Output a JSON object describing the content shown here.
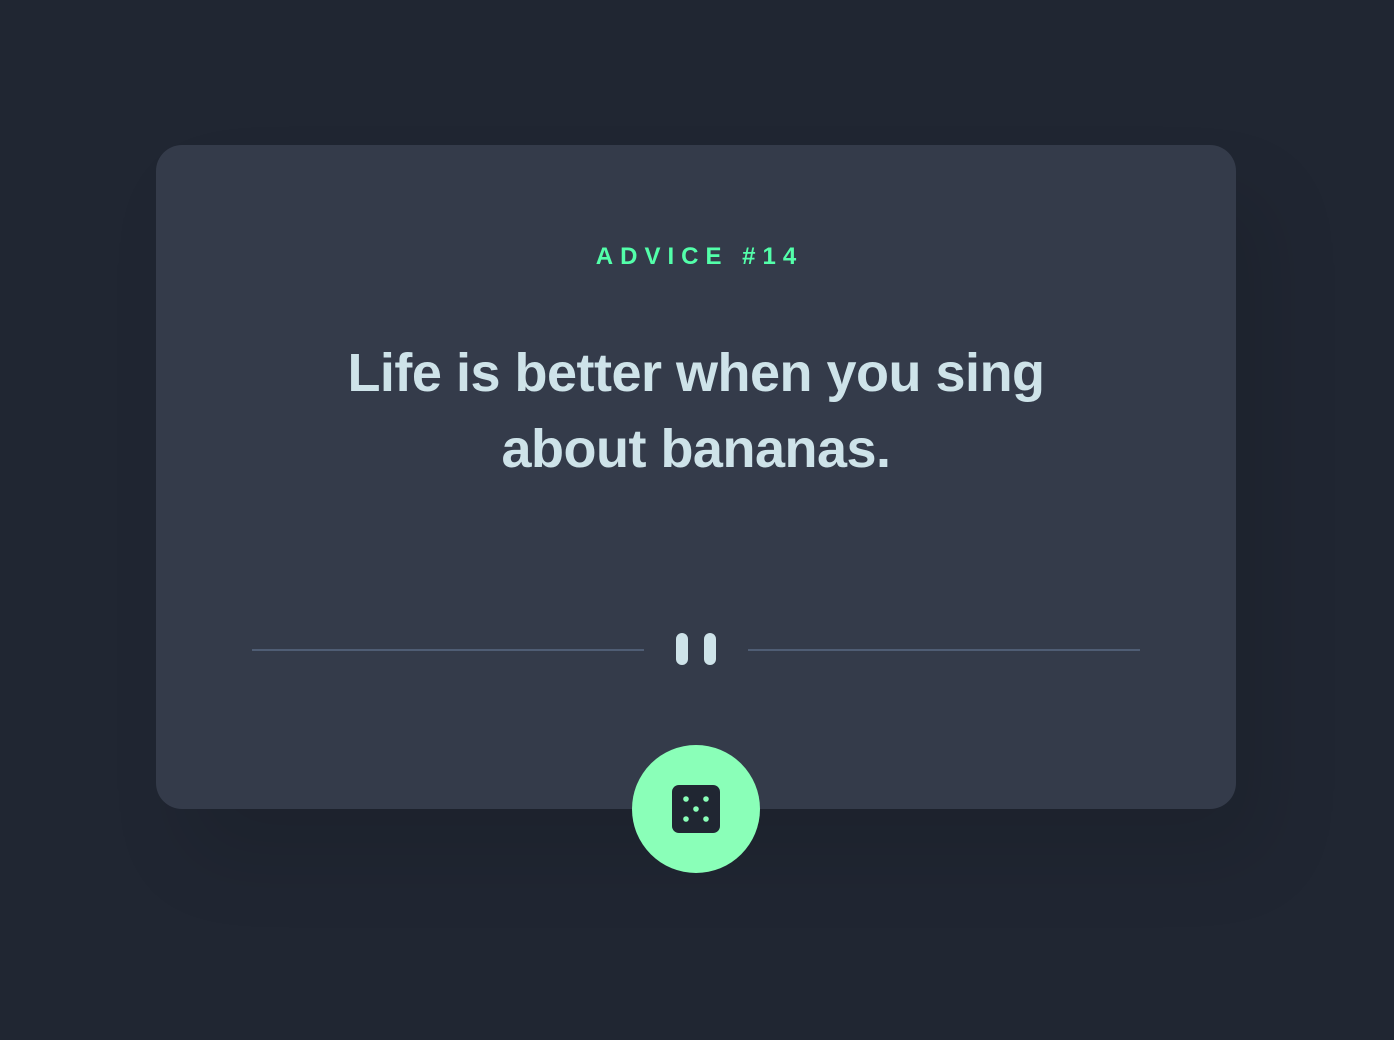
{
  "advice": {
    "label": "ADVICE #14",
    "text": "Life is better when you sing about bananas."
  },
  "icons": {
    "divider": "pause-icon",
    "button": "dice-icon"
  },
  "colors": {
    "background": "#202632",
    "card": "#343B4A",
    "accent": "#53FFAA",
    "button": "#8AFFB8",
    "text": "#CEE3E9",
    "divider": "#4F5D74"
  }
}
